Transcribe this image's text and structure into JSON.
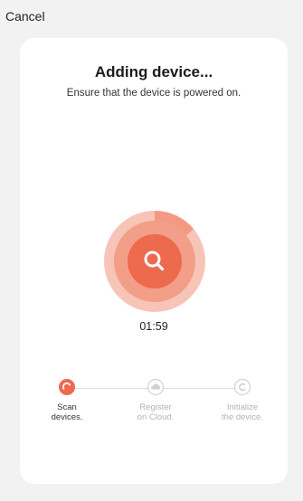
{
  "header": {
    "cancel_label": "Cancel"
  },
  "card": {
    "title": "Adding device...",
    "subtitle": "Ensure that the device is powered on.",
    "scan_icon": "search-icon",
    "timer": "01:59",
    "scan_progress": 0.14
  },
  "steps": [
    {
      "label": "Scan\ndevices.",
      "icon": "spinner-icon",
      "state": "active"
    },
    {
      "label": "Register\non Cloud.",
      "icon": "cloud-icon",
      "state": "pending"
    },
    {
      "label": "Initialize\nthe device.",
      "icon": "initialize-icon",
      "state": "pending"
    }
  ],
  "colors": {
    "accent": "#ee6a4f",
    "accent_ring_outer": "#f7c4b8",
    "accent_ring_mid": "#f29a84",
    "pending": "#d0d0d0"
  }
}
